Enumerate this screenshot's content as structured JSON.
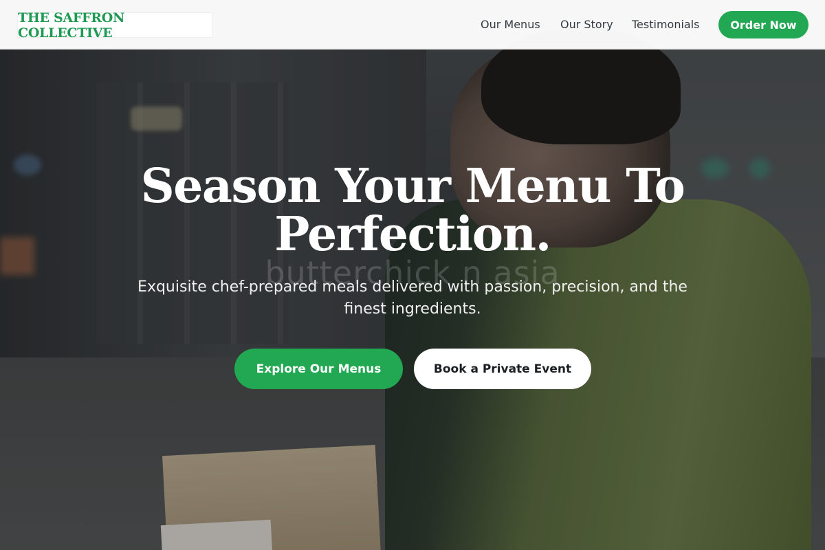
{
  "brand": {
    "name": "THE SAFFRON COLLECTIVE",
    "accent_color": "#22a852"
  },
  "nav": {
    "items": [
      {
        "label": "Our Menus"
      },
      {
        "label": "Our Story"
      },
      {
        "label": "Testimonials"
      }
    ],
    "cta_label": "Order Now"
  },
  "hero": {
    "title": "Season Your Menu To Perfection.",
    "subtitle": "Exquisite chef-prepared meals delivered with passion, precision, and the finest ingredients.",
    "watermark": "butterchick n asia",
    "primary_button": "Explore Our Menus",
    "secondary_button": "Book a Private Event",
    "background_image": "delivery-person-carrying-box"
  }
}
